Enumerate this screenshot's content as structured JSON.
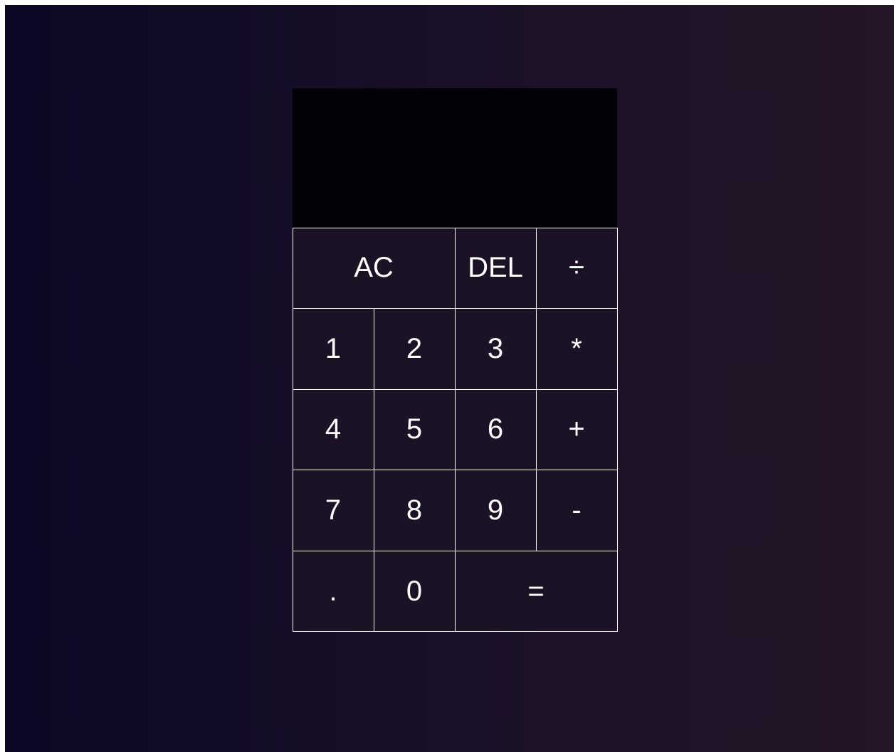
{
  "display": {
    "previous_operand": "",
    "current_operand": ""
  },
  "keys": {
    "all_clear": "AC",
    "delete": "DEL",
    "divide": "÷",
    "one": "1",
    "two": "2",
    "three": "3",
    "multiply": "*",
    "four": "4",
    "five": "5",
    "six": "6",
    "plus": "+",
    "seven": "7",
    "eight": "8",
    "nine": "9",
    "minus": "-",
    "decimal": ".",
    "zero": "0",
    "equals": "="
  },
  "colors": {
    "background_left": "#0c0825",
    "background_right": "#241527",
    "display_bg": "#040008",
    "key_bg": "#1c1226",
    "key_border": "#ffffff",
    "text": "#ffffff"
  }
}
